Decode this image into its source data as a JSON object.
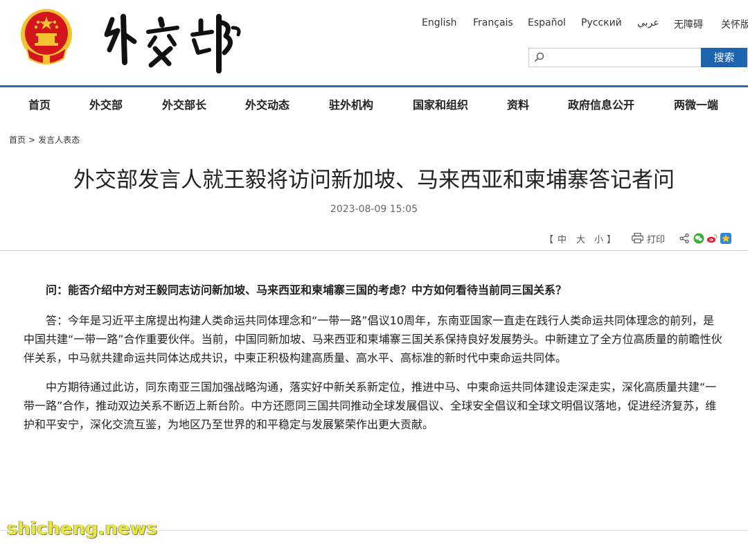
{
  "header": {
    "site_name": "外交部",
    "languages": [
      "English",
      "Français",
      "Español",
      "Русский",
      "عربي",
      "无障碍",
      "关怀版"
    ],
    "search_placeholder": "",
    "search_button": "搜索"
  },
  "nav": {
    "items": [
      "首页",
      "外交部",
      "外交部长",
      "外交动态",
      "驻外机构",
      "国家和组织",
      "资料",
      "政府信息公开",
      "两微一端"
    ]
  },
  "breadcrumb": {
    "home": "首页",
    "separator": ">",
    "current": "发言人表态"
  },
  "article": {
    "title": "外交部发言人就王毅将访问新加坡、马来西亚和柬埔寨答记者问",
    "date": "2023-08-09 15:05",
    "font_size_open": "【",
    "font_size_large": "中",
    "font_size_medium": "大",
    "font_size_small": "小",
    "font_size_close": "】",
    "print_label": "打印",
    "question": "问：能否介绍中方对王毅同志访问新加坡、马来西亚和柬埔寨三国的考虑？中方如何看待当前同三国关系？",
    "paragraphs": [
      "答：今年是习近平主席提出构建人类命运共同体理念和“一带一路”倡议10周年，东南亚国家一直走在践行人类命运共同体理念的前列，是中国共建“一带一路”合作重要伙伴。当前，中国同新加坡、马来西亚和柬埔寨三国关系保持良好发展势头。中新建立了全方位高质量的前瞻性伙伴关系，中马就共建命运共同体达成共识，中柬正积极构建高质量、高水平、高标准的新时代中柬命运共同体。",
      "中方期待通过此访，同东南亚三国加强战略沟通，落实好中新关系新定位，推进中马、中柬命运共同体建设走深走实，深化高质量共建“一带一路”合作，推动双边关系不断迈上新台阶。中方还愿同三国共同推动全球发展倡议、全球安全倡议和全球文明倡议落地，促进经济复苏，维护和平安宁，深化交流互鉴，为地区乃至世界的和平稳定与发展繁荣作出更大贡献。"
    ]
  },
  "watermark": "shicheng.news",
  "colors": {
    "accent": "#1e63ae",
    "divider": "#2c6db3",
    "emblem_red": "#d4161c",
    "emblem_gold": "#f2c230"
  }
}
